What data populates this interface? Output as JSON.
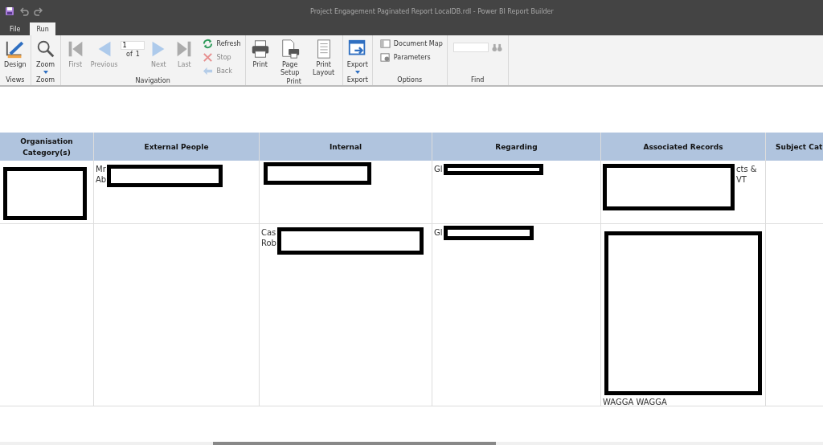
{
  "window": {
    "title": "Project Engagement Paginated Report LocalDB.rdl - Power BI Report Builder"
  },
  "tabs": [
    {
      "label": "File",
      "selected": false
    },
    {
      "label": "Run",
      "selected": true
    }
  ],
  "ribbon": {
    "groups": [
      {
        "label": "Views",
        "items": [
          {
            "kind": "large",
            "label": "Design",
            "disabled": false
          }
        ]
      },
      {
        "label": "Zoom",
        "items": [
          {
            "kind": "large",
            "label": "Zoom",
            "dropdown": true,
            "disabled": false
          }
        ]
      },
      {
        "label": "Navigation",
        "items": [
          {
            "kind": "large",
            "label": "First",
            "disabled": true
          },
          {
            "kind": "large",
            "label": "Previous",
            "disabled": true
          },
          {
            "kind": "page",
            "value": "1",
            "of": "of",
            "total": "1"
          },
          {
            "kind": "large",
            "label": "Next",
            "disabled": true
          },
          {
            "kind": "large",
            "label": "Last",
            "disabled": true
          },
          {
            "kind": "stack",
            "items": [
              {
                "label": "Refresh",
                "disabled": false
              },
              {
                "label": "Stop",
                "disabled": true
              },
              {
                "label": "Back",
                "disabled": true
              }
            ]
          }
        ]
      },
      {
        "label": "Print",
        "items": [
          {
            "kind": "large",
            "label": "Print",
            "disabled": false
          },
          {
            "kind": "large",
            "label": "Page Setup",
            "disabled": false
          },
          {
            "kind": "large",
            "label": "Print Layout",
            "disabled": false
          }
        ]
      },
      {
        "label": "Export",
        "items": [
          {
            "kind": "large",
            "label": "Export",
            "dropdown": true,
            "disabled": false
          }
        ]
      },
      {
        "label": "Options",
        "items": [
          {
            "kind": "stack",
            "items": [
              {
                "label": "Document Map",
                "disabled": false
              },
              {
                "label": "Parameters",
                "disabled": false
              }
            ]
          }
        ]
      },
      {
        "label": "Find",
        "items": [
          {
            "kind": "find"
          }
        ]
      }
    ]
  },
  "table": {
    "columns": [
      "Organisation Category(s)",
      "External People",
      "Internal",
      "Regarding",
      "Associated Records",
      "Subject Cat"
    ],
    "rows": [
      {
        "cells": [
          {
            "redacted": true
          },
          {
            "lines": [
              "Mr",
              "Ab"
            ],
            "redacted": true
          },
          {
            "redacted": true
          },
          {
            "lines": [
              "Gl"
            ],
            "redacted": true
          },
          {
            "lines": [
              "cts &",
              "VT"
            ],
            "redacted": true
          },
          {
            "redacted": false
          }
        ]
      },
      {
        "cells": [
          {
            "redacted": false
          },
          {
            "redacted": false
          },
          {
            "lines": [
              "Cas",
              "Rob"
            ],
            "redacted": true
          },
          {
            "lines": [
              "Gl"
            ],
            "redacted": true
          },
          {
            "lines": [
              "WAGGA WAGGA"
            ],
            "redacted": true
          },
          {
            "redacted": false
          }
        ]
      }
    ]
  }
}
